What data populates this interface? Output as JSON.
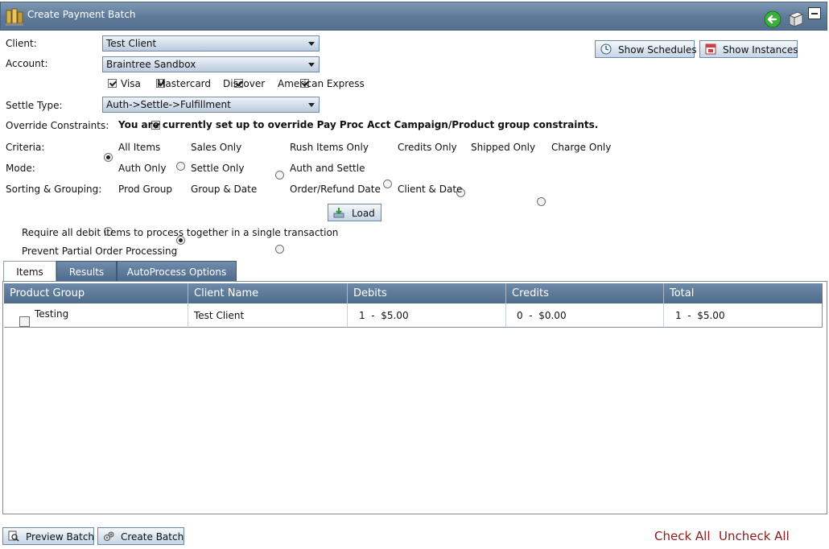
{
  "window": {
    "title": "Create Payment Batch"
  },
  "form": {
    "client_label": "Client:",
    "client_value": "Test Client",
    "account_label": "Account:",
    "account_value": "Braintree Sandbox",
    "card_types": [
      {
        "label": "Visa",
        "checked": true
      },
      {
        "label": "Mastercard",
        "checked": true
      },
      {
        "label": "Discover",
        "checked": true
      },
      {
        "label": "American Express",
        "checked": true
      }
    ],
    "settle_type_label": "Settle Type:",
    "settle_type_value": "Auth->Settle->Fulfillment",
    "override_label": "Override Constraints:",
    "override_text": "You are currently set up to override Pay Proc Acct Campaign/Product group constraints.",
    "criteria_label": "Criteria:",
    "criteria_options": [
      "All Items",
      "Sales Only",
      "Rush Items Only",
      "Credits Only",
      "Shipped Only",
      "Charge Only"
    ],
    "criteria_selected": "All Items",
    "mode_label": "Mode:",
    "mode_options": [
      "Auth Only",
      "Settle Only",
      "Auth and Settle"
    ],
    "mode_selected": "Settle Only",
    "sorting_label": "Sorting & Grouping:",
    "sorting_options": [
      "Prod Group",
      "Group & Date",
      "Order/Refund Date",
      "Client & Date"
    ],
    "sorting_selected": "Prod Group",
    "load_label": "Load",
    "require_debit_label": "Require all debit items to process together in a single transaction",
    "prevent_partial_label": "Prevent Partial Order Processing"
  },
  "toolbar": {
    "show_schedules_label": "Show Schedules",
    "show_instances_label": "Show Instances"
  },
  "tabs": [
    {
      "label": "Items",
      "active": true
    },
    {
      "label": "Results",
      "active": false
    },
    {
      "label": "AutoProcess Options",
      "active": false
    }
  ],
  "grid": {
    "columns": [
      "Product Group",
      "Client Name",
      "Debits",
      "Credits",
      "Total"
    ],
    "rows": [
      {
        "product_group": "Testing",
        "client_name": "Test Client",
        "debits": "1  -  $5.00",
        "credits": "0  -  $0.00",
        "total": "1  -  $5.00"
      }
    ]
  },
  "footer": {
    "preview_batch_label": "Preview Batch",
    "create_batch_label": "Create Batch",
    "check_all_label": "Check All",
    "uncheck_all_label": "Uncheck All"
  },
  "colors": {
    "titlebar": "#5d7998",
    "grid_header": "#5f7b9a",
    "link": "#8b1a1a"
  }
}
